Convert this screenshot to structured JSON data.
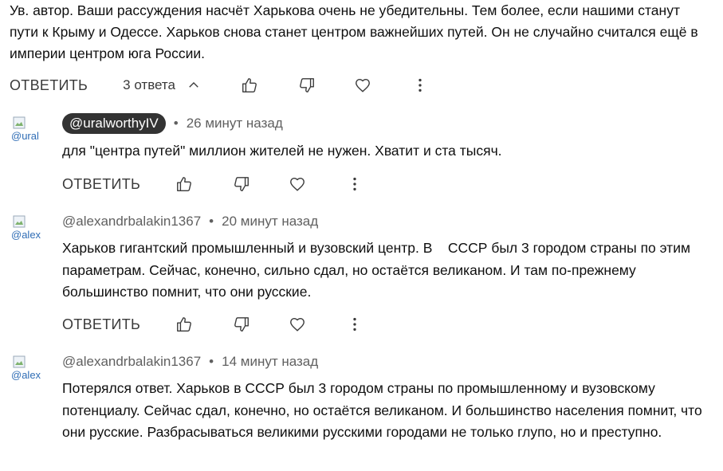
{
  "parent": {
    "text": "Ув. автор. Ваши рассуждения насчёт Харькова очень не убедительны. Тем более, если нашими станут пути к Крыму и Одессе. Харьков снова станет центром важнейших путей. Он не случайно считался ещё в империи центром юга России.",
    "reply_label": "ОТВЕТИТЬ",
    "replies_toggle": "3 ответа"
  },
  "replies": [
    {
      "avatar_alt": "@ural",
      "author": "@uralworthyIV",
      "time": "26 минут назад",
      "text": "для \"центра путей\" миллион жителей не нужен. Хватит и ста тысяч.",
      "reply_label": "ОТВЕТИТЬ"
    },
    {
      "avatar_alt": "@alex",
      "author": "@alexandrbalakin1367",
      "time": "20 минут назад",
      "text": "Харьков гигантский промышленный и вузовский центр. В    СССР был 3 городом страны по этим параметрам. Сейчас, конечно, сильно сдал, но остаётся великаном. И там по-прежнему большинство помнит, что они русские.",
      "reply_label": "ОТВЕТИТЬ"
    },
    {
      "avatar_alt": "@alex",
      "author": "@alexandrbalakin1367",
      "time": "14 минут назад",
      "text": "Потерялся ответ. Харьков в СССР был 3 городом страны по промышленному и вузовскому потенциалу. Сейчас сдал, конечно, но остаётся великаном. И большинство населения помнит, что они русские. Разбрасываться великими русскими городами не только глупо, но и преступно."
    }
  ],
  "icons": {
    "like": "thumb-up-icon",
    "dislike": "thumb-down-icon",
    "heart": "heart-icon",
    "more": "more-vert-icon",
    "chevron": "chevron-up-icon"
  }
}
